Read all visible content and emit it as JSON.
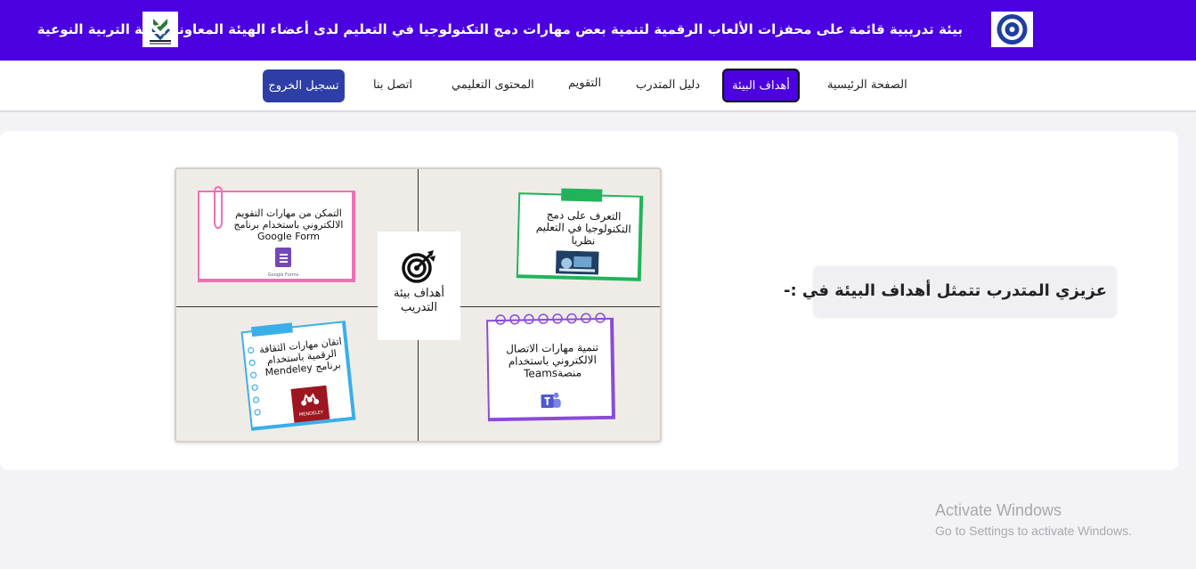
{
  "header": {
    "title": "بيئة تدريبية قائمة على محفزات الألعاب الرقمية لتنمية بعض مهارات دمج التكنولوجيا في التعليم لدى أعضاء الهيئة المعاونة بكلية التربية النوعية"
  },
  "nav": {
    "home": "الصفحة الرئيسية",
    "goals": "أهداف البيئة",
    "guide": "دليل المتدرب",
    "evaluation": "التقويم",
    "content": "المحتوى التعليمي",
    "contact": "اتصل بنا",
    "logout": "تسجيل الخروج"
  },
  "main": {
    "greeting": "عزيزي المتدرب تتمثل أهداف البيئة في :-",
    "center_label": "أهداف بيئة التدريب",
    "goals": [
      {
        "text": "التعرف على دمج التكنولوجيا في التعليم نظريا",
        "color": "#22b35a"
      },
      {
        "text": "التمكن من مهارات التقويم الالكتروني باستخدام برنامج Google Form",
        "color": "#f06fb5",
        "brand": "Google Forms"
      },
      {
        "text": "تنمية مهارات الاتصال الالكتروني باستخدام منصةTeams",
        "color": "#8a4bd8"
      },
      {
        "text": "اتقان مهارات الثقافة الرقمية باستخدام برنامج Mendeley",
        "color": "#3aaee8",
        "brand": "MENDELEY"
      }
    ]
  },
  "watermark": {
    "title": "Activate Windows",
    "subtitle": "Go to Settings to activate Windows."
  },
  "colors": {
    "header": "#4b01e0",
    "active_nav": "#4b01e0",
    "logout": "#2d3fa6"
  }
}
